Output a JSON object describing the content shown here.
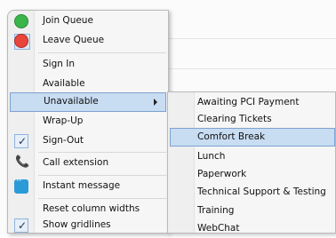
{
  "menu": {
    "items": [
      {
        "label": "Join Queue",
        "icon": "green-status-icon"
      },
      {
        "label": "Leave Queue",
        "icon": "red-status-icon"
      },
      {
        "label": "Sign In"
      },
      {
        "label": "Available"
      },
      {
        "label": "Unavailable",
        "has_submenu": true,
        "highlighted": true
      },
      {
        "label": "Wrap-Up"
      },
      {
        "label": "Sign-Out",
        "checked": true
      },
      {
        "label": "Call extension",
        "icon": "phone-icon"
      },
      {
        "label": "Instant message",
        "icon": "chat-icon"
      },
      {
        "label": "Reset column widths"
      },
      {
        "label": "Show gridlines",
        "checked": true
      }
    ]
  },
  "submenu": {
    "items": [
      {
        "label": "Awaiting PCI Payment"
      },
      {
        "label": "Clearing Tickets"
      },
      {
        "label": "Comfort Break",
        "highlighted": true
      },
      {
        "label": "Lunch"
      },
      {
        "label": "Paperwork"
      },
      {
        "label": "Technical Support & Testing"
      },
      {
        "label": "Training"
      },
      {
        "label": "WebChat"
      }
    ]
  },
  "colors": {
    "highlight": "#c8dcf2",
    "highlight_border": "#7da2ce",
    "green": "#3ab54a",
    "red": "#e8453c",
    "accent_blue": "#2a9bd7"
  }
}
